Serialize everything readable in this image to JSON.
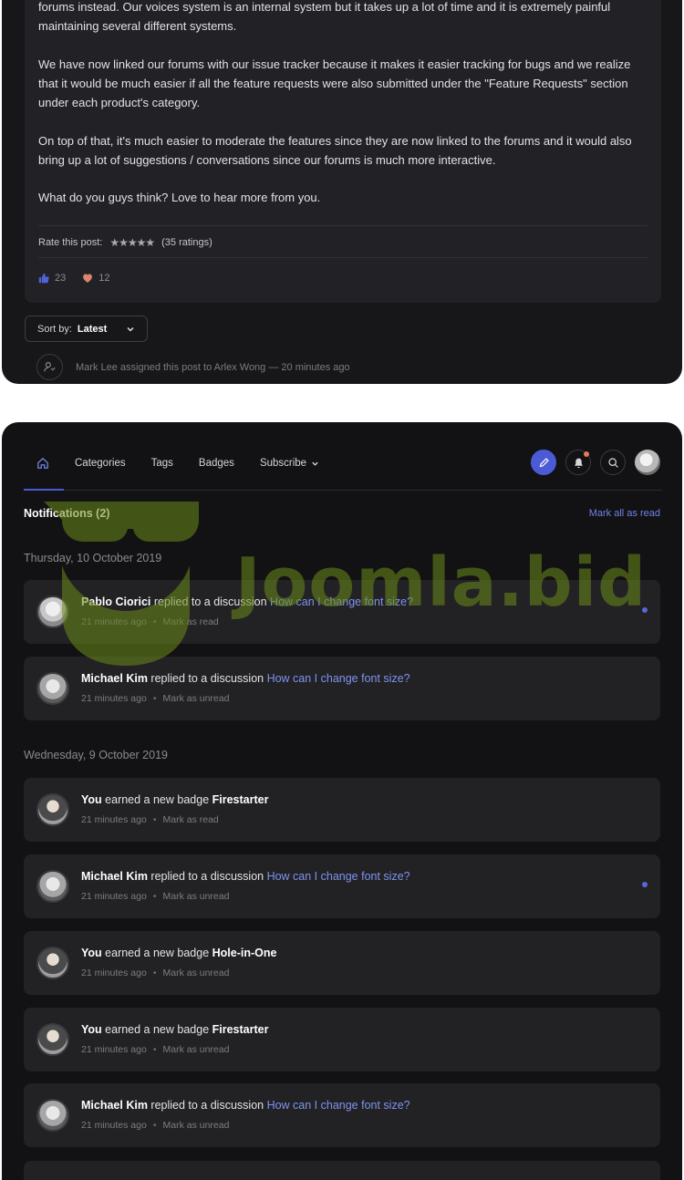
{
  "post": {
    "paragraphs": [
      "forums instead. Our voices system is an internal system but it takes up a lot of time and it is extremely painful maintaining several different systems.",
      "We have now linked our forums with our issue tracker because it makes it easier tracking for bugs and we realize that it would be much easier if all the feature requests were also submitted under the \"Feature Requests\" section under each product's category.",
      "On top of that, it's much easier to moderate the features since they are now linked to the forums and it would also bring up a lot of suggestions / conversations since our forums is much more interactive.",
      "What do you guys think? Love to hear more from you."
    ],
    "rate_label": "Rate this post:",
    "stars": "★★★★★",
    "ratings_count": "(35 ratings)",
    "likes": "23",
    "hearts": "12"
  },
  "sort": {
    "label": "Sort by:",
    "value": "Latest"
  },
  "activity": {
    "text": "Mark Lee assigned this post to Arlex Wong — 20 minutes ago"
  },
  "nav": {
    "items": [
      "Categories",
      "Tags",
      "Badges",
      "Subscribe"
    ]
  },
  "notifications": {
    "title": "Notifications (2)",
    "mark_all": "Mark all as read",
    "groups": [
      {
        "date": "Thursday, 10 October 2019"
      },
      {
        "date": "Wednesday, 9 October 2019"
      }
    ],
    "items": [
      {
        "who": "Pablo Ciorici",
        "action": " replied to a discussion ",
        "link": "How can I change font size?",
        "time": "21 minutes ago",
        "mark": "Mark as read",
        "unread": true
      },
      {
        "who": "Michael Kim",
        "action": " replied to a discussion ",
        "link": "How can I change font size?",
        "time": "21 minutes ago",
        "mark": "Mark as unread",
        "unread": false
      },
      {
        "who": "You",
        "action": " earned a new badge ",
        "badge": "Firestarter",
        "time": "21 minutes ago",
        "mark": "Mark as read",
        "unread": false
      },
      {
        "who": "Michael Kim",
        "action": " replied to a discussion ",
        "link": "How can I change font size?",
        "time": "21 minutes ago",
        "mark": "Mark as unread",
        "unread": true
      },
      {
        "who": "You",
        "action": " earned a new badge ",
        "badge": "Hole-in-One",
        "time": "21 minutes ago",
        "mark": "Mark as unread",
        "unread": false
      },
      {
        "who": "You",
        "action": " earned a new badge ",
        "badge": "Firestarter",
        "time": "21 minutes ago",
        "mark": "Mark as unread",
        "unread": false
      },
      {
        "who": "Michael Kim",
        "action": " replied to a discussion ",
        "link": "How can I change font size?",
        "time": "21 minutes ago",
        "mark": "Mark as unread",
        "unread": false
      }
    ]
  },
  "watermark": {
    "text": "Joomla.bid"
  },
  "colors": {
    "accent": "#4b5bd6",
    "link": "#7f93ee",
    "notif_dot": "#e57b5a",
    "panel": "#121214",
    "card": "#222225"
  },
  "icons": [
    "home-icon",
    "chevron-down-icon",
    "pencil-icon",
    "bell-icon",
    "search-icon",
    "thumbs-up-icon",
    "heart-icon",
    "assign-user-icon"
  ]
}
